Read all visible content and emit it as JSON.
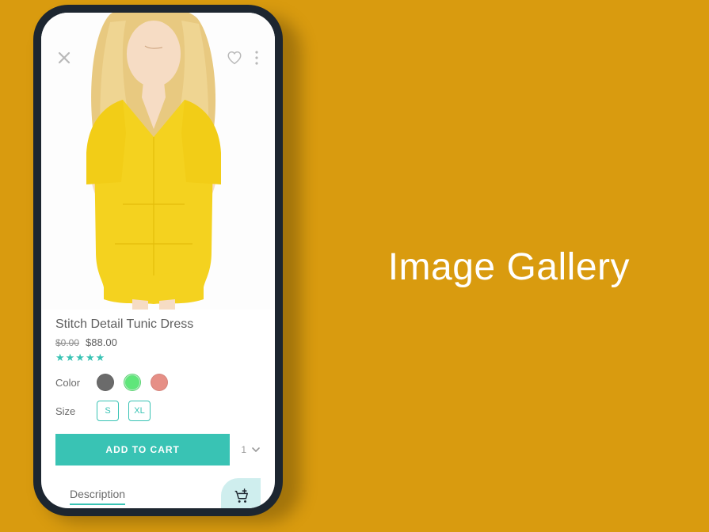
{
  "page": {
    "title": "Image Gallery"
  },
  "product": {
    "title": "Stitch Detail Tunic Dress",
    "price_old": "$0.00",
    "price_new": "$88.00",
    "rating_stars": "★★★★★",
    "color_label": "Color",
    "size_label": "Size",
    "sizes": [
      "S",
      "XL"
    ],
    "add_to_cart_label": "ADD TO CART",
    "quantity": "1"
  },
  "tabs": {
    "description": "Description"
  },
  "colors": {
    "grey": "#6b6b6b",
    "green": "#5fe67a",
    "rose": "#e68f86"
  }
}
